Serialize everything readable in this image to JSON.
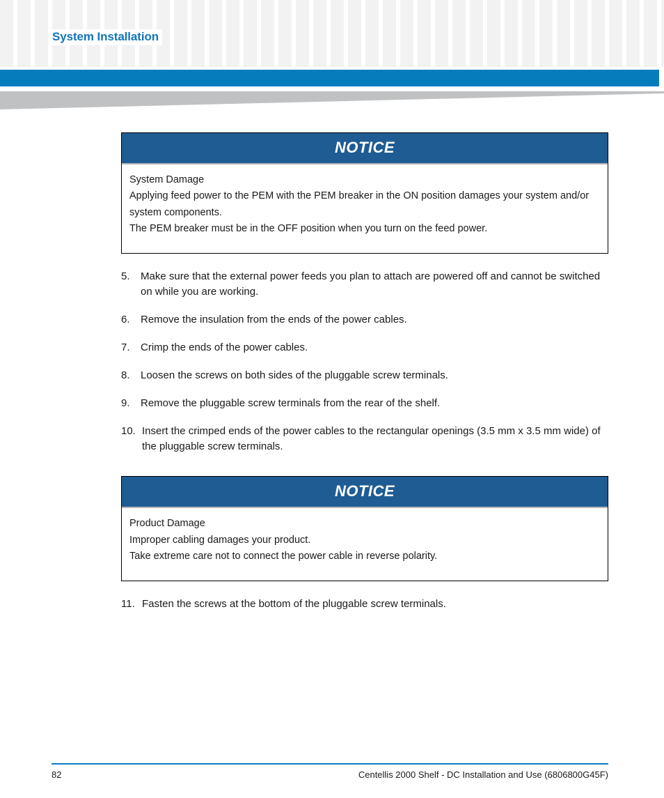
{
  "header": {
    "title": "System Installation"
  },
  "colors": {
    "heading_blue": "#1275B8",
    "banner_blue": "#077CBD",
    "notice_header_blue": "#1F5C93",
    "wedge_gray": "#BFC1C3",
    "pattern_gray": "#F2F2F2",
    "footer_rule_blue": "#0A7BBD"
  },
  "notices": [
    {
      "title": "NOTICE",
      "lines": [
        "System Damage",
        "Applying feed power to the PEM with the PEM breaker in the ON position damages your system and/or system components.",
        "The PEM breaker must be in the OFF position when you turn on the feed power."
      ]
    },
    {
      "title": "NOTICE",
      "lines": [
        "Product Damage",
        "Improper cabling damages your product.",
        "Take extreme care not to connect the power cable in reverse polarity."
      ]
    }
  ],
  "steps_before_second_notice": [
    {
      "number": "5.",
      "text": "Make sure that the external power feeds you plan to attach are powered off and cannot be switched on while you are working."
    },
    {
      "number": "6.",
      "text": "Remove the insulation from the ends of the power cables."
    },
    {
      "number": "7.",
      "text": "Crimp the ends of the power cables."
    },
    {
      "number": "8.",
      "text": "Loosen the screws on both sides of the pluggable screw terminals."
    },
    {
      "number": "9.",
      "text": "Remove the pluggable screw terminals from the rear of the shelf."
    },
    {
      "number": "10.",
      "text": "Insert the crimped ends of the power cables to the rectangular openings (3.5 mm x 3.5 mm wide) of the pluggable screw terminals."
    }
  ],
  "steps_after_second_notice": [
    {
      "number": "11.",
      "text": "Fasten the screws at the bottom of the pluggable screw terminals."
    }
  ],
  "footer": {
    "page_number": "82",
    "document_title": "Centellis 2000 Shelf - DC Installation and Use (6806800G45F)"
  }
}
